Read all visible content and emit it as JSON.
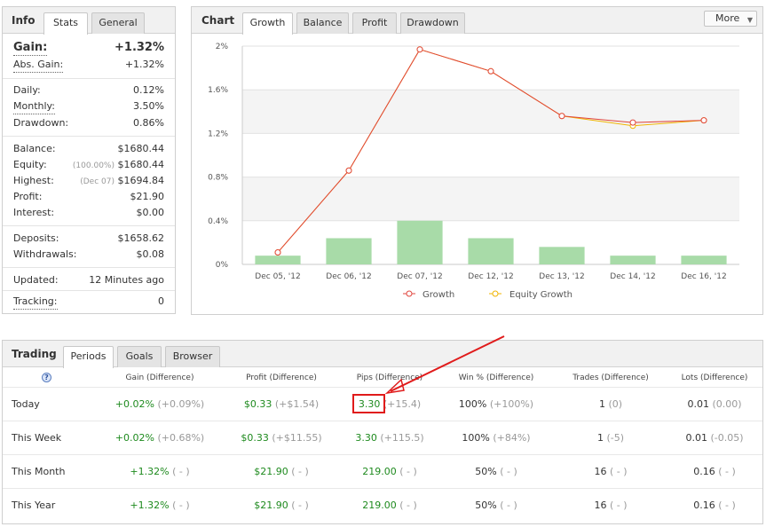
{
  "info": {
    "title": "Info",
    "tabs": [
      "Stats",
      "General"
    ],
    "gain_label": "Gain:",
    "gain_value": "+1.32%",
    "abs_gain_label": "Abs. Gain:",
    "abs_gain_value": "+1.32%",
    "daily_label": "Daily:",
    "daily_value": "0.12%",
    "monthly_label": "Monthly:",
    "monthly_value": "3.50%",
    "drawdown_label": "Drawdown:",
    "drawdown_value": "0.86%",
    "balance_label": "Balance:",
    "balance_value": "$1680.44",
    "equity_label": "Equity:",
    "equity_note": "(100.00%)",
    "equity_value": "$1680.44",
    "highest_label": "Highest:",
    "highest_note": "(Dec 07)",
    "highest_value": "$1694.84",
    "profit_label": "Profit:",
    "profit_value": "$21.90",
    "interest_label": "Interest:",
    "interest_value": "$0.00",
    "deposits_label": "Deposits:",
    "deposits_value": "$1658.62",
    "withdrawals_label": "Withdrawals:",
    "withdrawals_value": "$0.08",
    "updated_label": "Updated:",
    "updated_value": "12 Minutes ago",
    "tracking_label": "Tracking:",
    "tracking_value": "0"
  },
  "chart": {
    "title": "Chart",
    "tabs": [
      "Growth",
      "Balance",
      "Profit",
      "Drawdown"
    ],
    "more_label": "More",
    "colors": {
      "growth": "#e0453c",
      "equity": "#f0b400",
      "bars": "#a8dba8"
    }
  },
  "chart_data": {
    "type": "line",
    "categories": [
      "Dec 05, '12",
      "Dec 06, '12",
      "Dec 07, '12",
      "Dec 12, '12",
      "Dec 13, '12",
      "Dec 14, '12",
      "Dec 16, '12"
    ],
    "series": [
      {
        "name": "Growth",
        "values": [
          0.11,
          0.86,
          1.97,
          1.77,
          1.36,
          1.3,
          1.32
        ]
      },
      {
        "name": "Equity Growth",
        "values": [
          0.11,
          0.86,
          1.97,
          1.77,
          1.36,
          1.27,
          1.32
        ]
      }
    ],
    "bars": [
      0.08,
      0.24,
      0.4,
      0.24,
      0.16,
      0.08,
      0.08
    ],
    "yticks": [
      "0%",
      "0.4%",
      "0.8%",
      "1.2%",
      "1.6%",
      "2%"
    ],
    "ylim": [
      0,
      2
    ],
    "grid": true,
    "legend_position": "bottom"
  },
  "trading": {
    "title": "Trading",
    "tabs": [
      "Periods",
      "Goals",
      "Browser"
    ],
    "help_icon": "?",
    "headers": [
      "Gain (Difference)",
      "Profit (Difference)",
      "Pips (Difference)",
      "Win % (Difference)",
      "Trades (Difference)",
      "Lots (Difference)"
    ],
    "rows": [
      {
        "period": "Today",
        "gain": "+0.02%",
        "gain_diff": "(+0.09%)",
        "profit": "$0.33",
        "profit_diff": "(+$1.54)",
        "pips": "3.30",
        "pips_diff": "(+15.4)",
        "win": "100%",
        "win_diff": "(+100%)",
        "trades": "1",
        "trades_diff": "(0)",
        "lots": "0.01",
        "lots_diff": "(0.00)"
      },
      {
        "period": "This Week",
        "gain": "+0.02%",
        "gain_diff": "(+0.68%)",
        "profit": "$0.33",
        "profit_diff": "(+$11.55)",
        "pips": "3.30",
        "pips_diff": "(+115.5)",
        "win": "100%",
        "win_diff": "(+84%)",
        "trades": "1",
        "trades_diff": "(-5)",
        "lots": "0.01",
        "lots_diff": "(-0.05)"
      },
      {
        "period": "This Month",
        "gain": "+1.32%",
        "gain_diff": "( - )",
        "profit": "$21.90",
        "profit_diff": "( - )",
        "pips": "219.00",
        "pips_diff": "( - )",
        "win": "50%",
        "win_diff": "( - )",
        "trades": "16",
        "trades_diff": "( - )",
        "lots": "0.16",
        "lots_diff": "( - )"
      },
      {
        "period": "This Year",
        "gain": "+1.32%",
        "gain_diff": "( - )",
        "profit": "$21.90",
        "profit_diff": "( - )",
        "pips": "219.00",
        "pips_diff": "( - )",
        "win": "50%",
        "win_diff": "( - )",
        "trades": "16",
        "trades_diff": "( - )",
        "lots": "0.16",
        "lots_diff": "( - )"
      }
    ]
  }
}
